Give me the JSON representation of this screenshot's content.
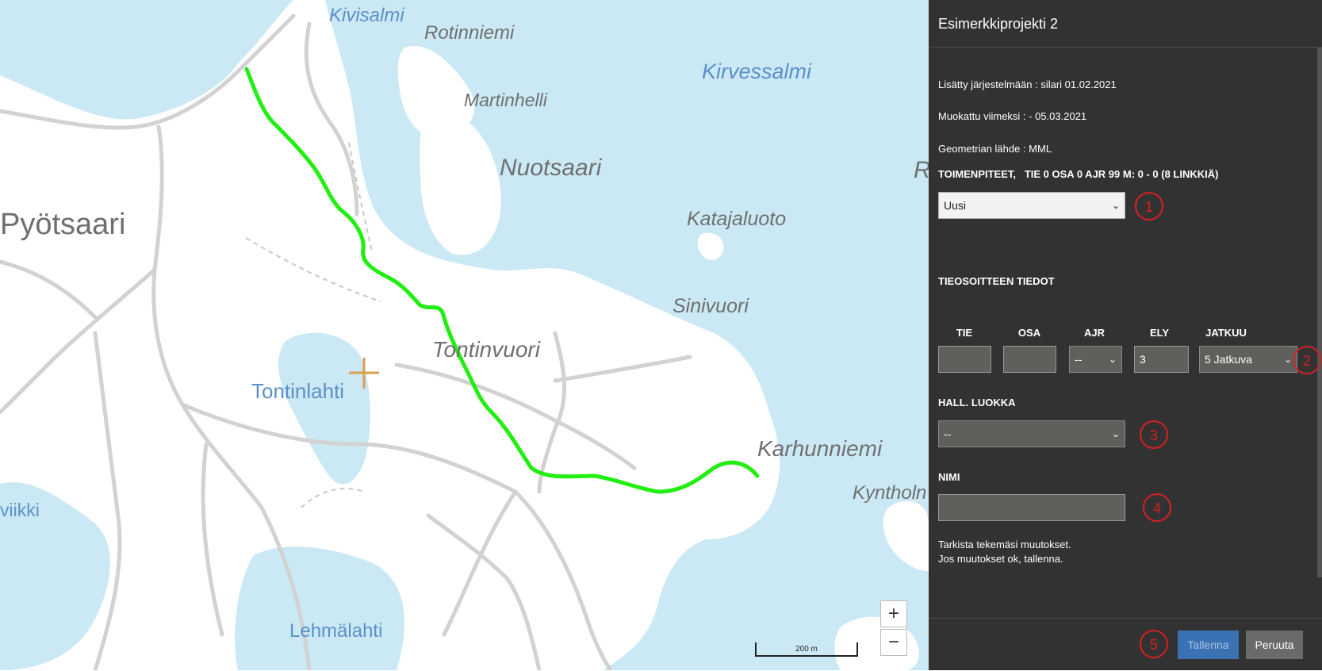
{
  "map": {
    "labels": [
      {
        "text": "Kivisalmi",
        "kind": "water"
      },
      {
        "text": "Rotinniemi",
        "kind": "land"
      },
      {
        "text": "Kirvessalmi",
        "kind": "water"
      },
      {
        "text": "Martinhelli",
        "kind": "land"
      },
      {
        "text": "Nuotsaari",
        "kind": "land"
      },
      {
        "text": "Pyötsaari",
        "kind": "land"
      },
      {
        "text": "Katajaluoto",
        "kind": "land"
      },
      {
        "text": "Sinivuori",
        "kind": "land"
      },
      {
        "text": "Tontinvuori",
        "kind": "land"
      },
      {
        "text": "Tontinlahti",
        "kind": "water"
      },
      {
        "text": "Karhunniemi",
        "kind": "land"
      },
      {
        "text": "Kyntholn",
        "kind": "land"
      },
      {
        "text": "viikki",
        "kind": "water"
      },
      {
        "text": "Lehmälahti",
        "kind": "water"
      },
      {
        "text": "R",
        "kind": "land"
      }
    ],
    "zoom_in_label": "+",
    "zoom_out_label": "−",
    "scale_label": "200 m",
    "colors": {
      "water": "#cbe9f5",
      "land": "#ffffff",
      "road": "#d2d2d2",
      "route": "#22ee11"
    }
  },
  "panel": {
    "title": "Esimerkkiprojekti 2",
    "added": "Lisätty järjestelmään : silari 01.02.2021",
    "modified": "Muokattu viimeksi : - 05.03.2021",
    "geometry_source": "Geometrian lähde : MML",
    "actions_heading": "TOIMENPITEET,",
    "actions_detail": "TIE 0 OSA 0 AJR 99 M: 0 - 0 (8 LINKKIÄ)",
    "action_value": "Uusi",
    "address_heading": "TIEOSOITTEEN TIEDOT",
    "columns": [
      "TIE",
      "OSA",
      "AJR",
      "ELY",
      "JATKUU"
    ],
    "tie_value": "",
    "osa_value": "",
    "ajr_value": "--",
    "ely_value": "3",
    "jatkuu_value": "5 Jatkuva",
    "hall_heading": "HALL. LUOKKA",
    "hall_value": "--",
    "name_heading": "NIMI",
    "name_value": "",
    "check_line1": "Tarkista tekemäsi muutokset.",
    "check_line2": "Jos muutokset ok, tallenna.",
    "save_label": "Tallenna",
    "cancel_label": "Peruuta",
    "markers": [
      "1",
      "2",
      "3",
      "4",
      "5"
    ]
  }
}
